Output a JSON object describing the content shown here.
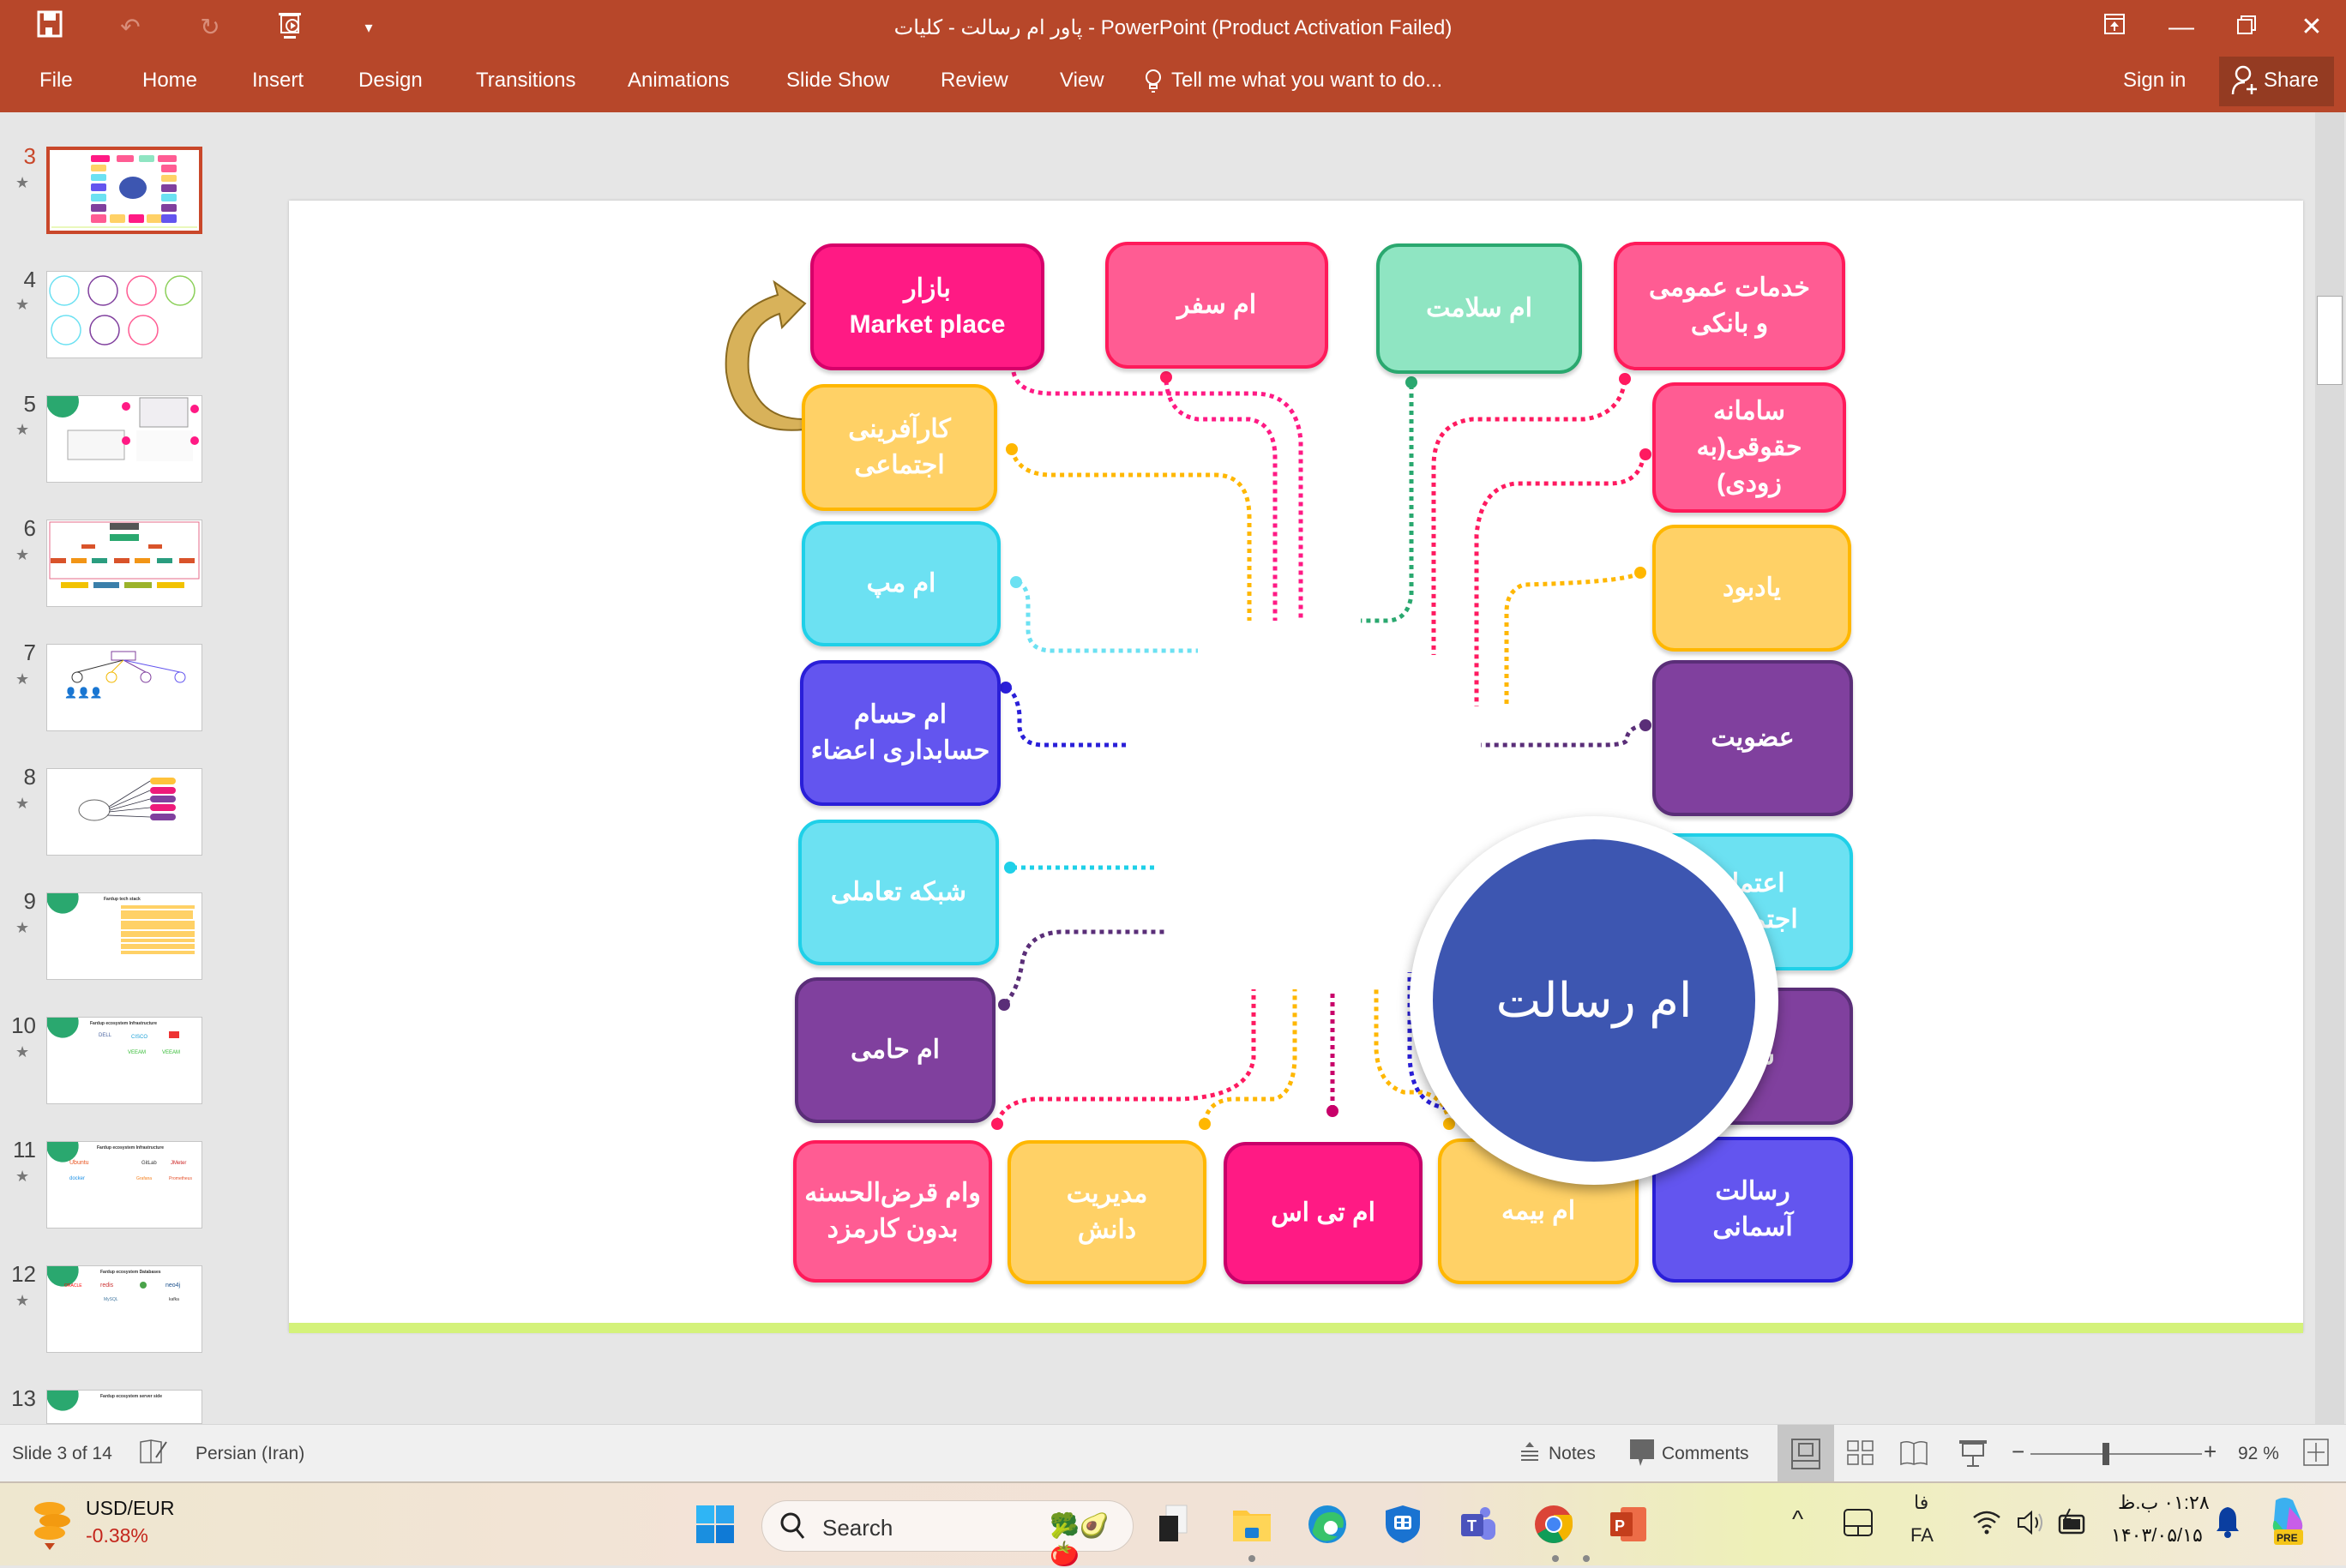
{
  "window": {
    "title": "پاور ام رسالت - کلیات - PowerPoint (Product Activation Failed)",
    "quick_access": [
      "save-icon",
      "undo-icon",
      "redo-icon",
      "start-from-beginning-icon",
      "customize-dropdown-icon"
    ],
    "controls": [
      "ribbon-display-options-icon",
      "minimize-icon",
      "restore-icon",
      "close-icon"
    ]
  },
  "ribbon": {
    "tabs": [
      "File",
      "Home",
      "Insert",
      "Design",
      "Transitions",
      "Animations",
      "Slide Show",
      "Review",
      "View"
    ],
    "tell_me": "Tell me what you want to do...",
    "sign_in": "Sign in",
    "share": "Share"
  },
  "thumbnails": [
    {
      "num": "3",
      "active": true
    },
    {
      "num": "4"
    },
    {
      "num": "5"
    },
    {
      "num": "6"
    },
    {
      "num": "7"
    },
    {
      "num": "8"
    },
    {
      "num": "9",
      "caption": "Fardup tech stack"
    },
    {
      "num": "10",
      "caption": "Fardup ecosystem Infrastructure"
    },
    {
      "num": "11",
      "caption": "Fardup ecosystem Infrastructure"
    },
    {
      "num": "12",
      "caption": "Fardup ecosystem Databases"
    },
    {
      "num": "13",
      "caption": "Fardup ecosystem server side"
    }
  ],
  "slide": {
    "hub": "ام رسالت",
    "boxes": {
      "bazar": "بازار\nMarket place",
      "safar": "ام سفر",
      "salamat": "ام سلامت",
      "khadamat": "خدمات عمومی\nو بانکی",
      "karafarini": "کارآفرینی\nاجتماعی",
      "hoghoghi": "سامانه\nحقوقی(به\nزودی)",
      "map": "ام مپ",
      "yadbood": "یادبود",
      "hesam": "ام حسام\nحسابداری اعضاء",
      "ozviat": "عضویت",
      "shabake": "شبکه تعاملی",
      "etemad": "اعتماد\nاجتماعی",
      "hami": "ام حامی",
      "saya": "سایا",
      "vam": "وام قرض‌الحسنه\nبدون کارمزد",
      "modiriat": "مدیریت\nدانش",
      "tias": "ام تی اس",
      "bime": "ام بیمه",
      "asemani": "رسالت\nآسمانی"
    },
    "colors": {
      "magenta": "#ff1a84",
      "pink": "#ff5c93",
      "mint": "#8fe5c2",
      "yellow": "#ffd166",
      "cyan": "#6ce1f2",
      "indigo": "#6355ef",
      "purple": "#80409e",
      "hub": "#3d56b1",
      "footer": "#d4f27a"
    }
  },
  "statusbar": {
    "slide_info": "Slide 3 of 14",
    "language": "Persian (Iran)",
    "notes": "Notes",
    "comments": "Comments",
    "zoom": "92 %",
    "zoom_level_percent": 92
  },
  "taskbar": {
    "widget_title": "USD/EUR",
    "widget_value": "-0.38%",
    "search_placeholder": "Search",
    "apps": [
      "start-icon",
      "task-view-icon",
      "file-explorer-icon",
      "edge-icon",
      "vpn-shield-icon",
      "teams-icon",
      "chrome-icon",
      "powerpoint-icon"
    ],
    "lang_top": "فا",
    "lang_bottom": "FA",
    "time": "۰۱:۲۸ ب.ظ",
    "date": "۱۴۰۳/۰۵/۱۵"
  }
}
